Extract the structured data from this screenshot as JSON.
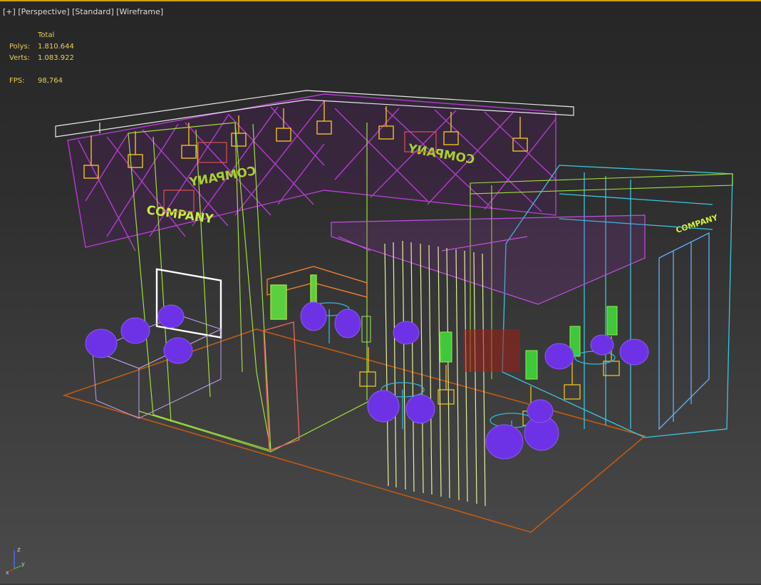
{
  "viewport": {
    "labels": [
      "[+]",
      "[Perspective]",
      "[Standard]",
      "[Wireframe]"
    ],
    "stats": {
      "header": "Total",
      "rows": [
        {
          "key": "Polys:",
          "value": "1.810.644"
        },
        {
          "key": "Verts:",
          "value": "1.083.922"
        }
      ],
      "fps_key": "FPS:",
      "fps_value": "98,764"
    },
    "signs": {
      "main": "COMPANY",
      "side": "COMPANY"
    },
    "axis": {
      "z": "z",
      "y": "y",
      "x": "x"
    }
  },
  "colors": {
    "accent_border": "#c8a000",
    "stats_text": "#e6d05a",
    "wall_magenta": "#b43cd0",
    "frame_green": "#9fe03a",
    "frame_cyan": "#38c8e0",
    "chair_purple": "#6e32e6",
    "floor_orange": "#c05a14"
  }
}
